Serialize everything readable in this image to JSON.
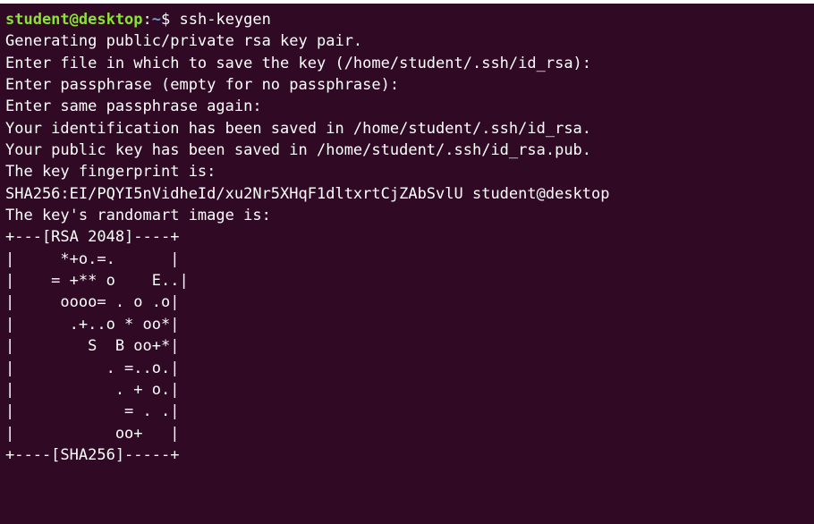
{
  "prompt": {
    "user_host": "student@desktop",
    "separator": ":",
    "path": "~",
    "symbol": "$ ",
    "command": "ssh-keygen"
  },
  "output_lines": [
    "Generating public/private rsa key pair.",
    "Enter file in which to save the key (/home/student/.ssh/id_rsa):",
    "Enter passphrase (empty for no passphrase):",
    "Enter same passphrase again:",
    "Your identification has been saved in /home/student/.ssh/id_rsa.",
    "Your public key has been saved in /home/student/.ssh/id_rsa.pub.",
    "The key fingerprint is:",
    "SHA256:EI/PQYI5nVidheId/xu2Nr5XHqF1dltxrtCjZAbSvlU student@desktop",
    "The key's randomart image is:",
    "+---[RSA 2048]----+",
    "|     *+o.=.      |",
    "|    = +** o    E..|",
    "|     oooo= . o .o|",
    "|      .+..o * oo*|",
    "|        S  B oo+*|",
    "|          . =..o.|",
    "|           . + o.|",
    "|            = . .|",
    "|           oo+   |",
    "+----[SHA256]-----+"
  ],
  "colors": {
    "background": "#300a24",
    "text": "#ffffff",
    "prompt_user": "#8ae234",
    "prompt_path": "#729fcf"
  }
}
